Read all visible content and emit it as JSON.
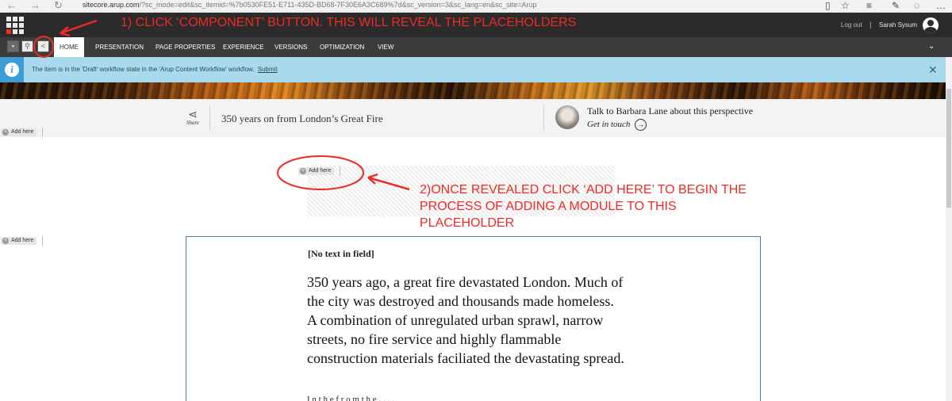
{
  "browser": {
    "back_icon": "back-arrow-icon",
    "forward_icon": "forward-arrow-icon",
    "refresh_icon": "refresh-icon",
    "url_host": "sitecore.arup.com",
    "url_path": "/?sc_mode=edit&sc_itemid=%7b0530FE51-E711-435D-BD68-7F30E6A3C689%7d&sc_version=3&sc_lang=en&sc_site=Arup"
  },
  "topbar": {
    "logout_label": "Log out",
    "separator": "|",
    "username": "Sarah Sysum"
  },
  "ribbon": {
    "tabs": [
      "HOME",
      "PRESENTATION",
      "PAGE PROPERTIES",
      "EXPERIENCE",
      "VERSIONS",
      "OPTIMIZATION",
      "VIEW"
    ],
    "save_icon": "save-icon",
    "search_icon": "search-icon",
    "component_icon": "component-icon",
    "collapse_icon": "chevron-down-icon"
  },
  "notification": {
    "text": "The item is in the 'Draft' workflow state in the 'Arup Content Workflow' workflow.",
    "link": "Submit",
    "info_icon": "info-icon",
    "close_icon": "close-icon"
  },
  "article_bar": {
    "share_label": "Share",
    "title": "350 years on from London’s Great Fire",
    "talk_title": "Talk to Barbara Lane about this perspective",
    "talk_link": "Get in touch",
    "arrow": "→"
  },
  "placeholders": {
    "add_label": "Add here",
    "plus": "+"
  },
  "content": {
    "empty_field": "[No text in field]",
    "lead": "350 years ago, a great fire devastated London. Much of the city was destroyed and thousands made homeless. A combination of unregulated urban sprawl, narrow streets, no fire service and highly flammable construction materials faciliated the devastating spread."
  },
  "annotations": {
    "step1": "1) CLICK ‘COMPONENT’ BUTTON. THIS WILL REVEAL THE PLACEHOLDERS",
    "step2": "2)ONCE REVEALED CLICK ‘ADD HERE’ TO BEGIN THE PROCESS OF ADDING A MODULE TO THIS PLACEHOLDER"
  },
  "colors": {
    "annotation_red": "#ee2a24",
    "topbar": "#2b2b2b",
    "ribbon": "#3c3c3c",
    "notify_bg": "#a9d9ec",
    "info_blue": "#3d9ed5"
  }
}
